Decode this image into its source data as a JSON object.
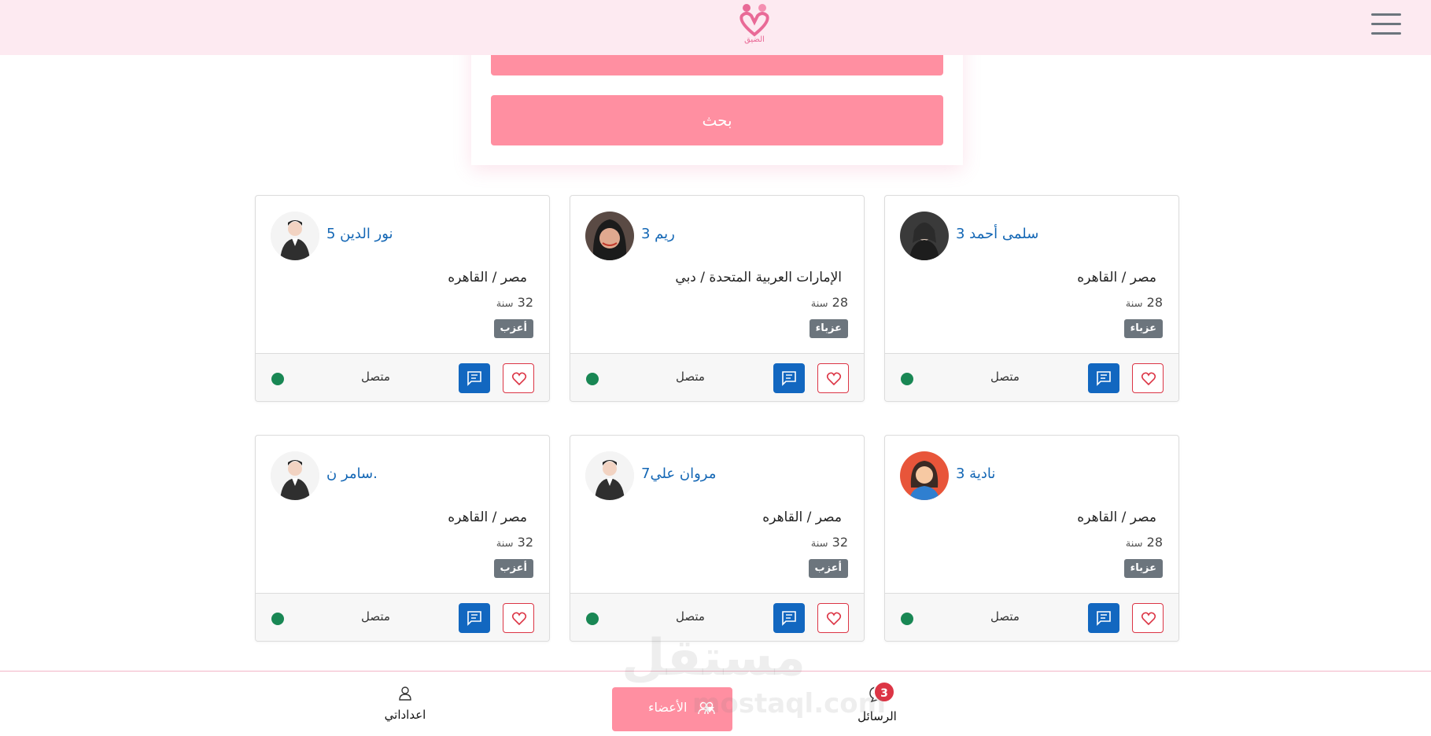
{
  "header": {
    "logo_text": "الضيق",
    "brand_color": "#e96a97"
  },
  "search": {
    "button_label": "بحث",
    "accent_color": "#ff8fa1"
  },
  "cards": [
    {
      "name": "سلمى أحمد 3",
      "location": "مصر / القاهره",
      "age": "28",
      "age_unit": "سنة",
      "status": "عزباء",
      "online": "متصل",
      "avatar": "female-hijab"
    },
    {
      "name": "ريم 3",
      "location": "الإمارات العربية المتحدة / دبي",
      "age": "28",
      "age_unit": "سنة",
      "status": "عزباء",
      "online": "متصل",
      "avatar": "female-headscarf"
    },
    {
      "name": "نور الدين 5",
      "location": "مصر / القاهره",
      "age": "32",
      "age_unit": "سنة",
      "status": "أعزب",
      "online": "متصل",
      "avatar": "male-default"
    },
    {
      "name": "نادية 3",
      "location": "مصر / القاهره",
      "age": "28",
      "age_unit": "سنة",
      "status": "عزباء",
      "online": "متصل",
      "avatar": "female-default"
    },
    {
      "name": "مروان علي7",
      "location": "مصر / القاهره",
      "age": "32",
      "age_unit": "سنة",
      "status": "أعزب",
      "online": "متصل",
      "avatar": "male-default"
    },
    {
      "name": "سامر ن.",
      "location": "مصر / القاهره",
      "age": "32",
      "age_unit": "سنة",
      "status": "أعزب",
      "online": "متصل",
      "avatar": "male-default"
    }
  ],
  "bottom_nav": {
    "settings_label": "اعداداتي",
    "members_label": "الأعضاء",
    "messages_label": "الرسائل",
    "messages_count": "3"
  },
  "watermark": {
    "main": "مستقل",
    "sub": "mostaql.com"
  },
  "colors": {
    "online": "#198754",
    "message_button": "#1267c0",
    "favorite_border": "#dc3545",
    "status_badge": "#6c757d",
    "name_link": "#1467b5"
  }
}
